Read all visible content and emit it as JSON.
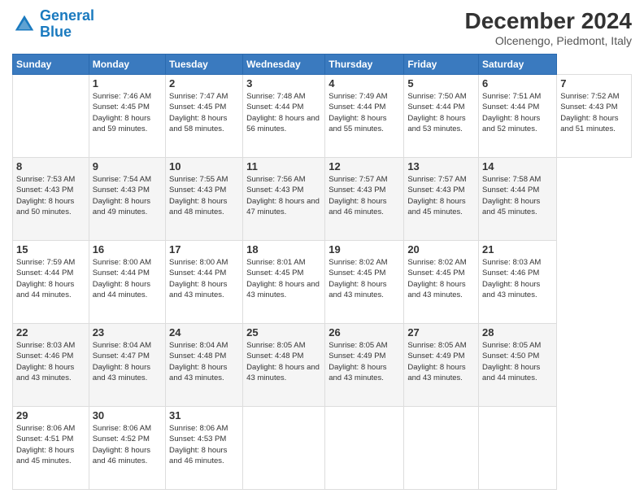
{
  "header": {
    "logo_line1": "General",
    "logo_line2": "Blue",
    "title": "December 2024",
    "subtitle": "Olcenengo, Piedmont, Italy"
  },
  "calendar": {
    "days_of_week": [
      "Sunday",
      "Monday",
      "Tuesday",
      "Wednesday",
      "Thursday",
      "Friday",
      "Saturday"
    ],
    "weeks": [
      [
        null,
        {
          "day": "1",
          "sunrise": "Sunrise: 7:46 AM",
          "sunset": "Sunset: 4:45 PM",
          "daylight": "Daylight: 8 hours and 59 minutes."
        },
        {
          "day": "2",
          "sunrise": "Sunrise: 7:47 AM",
          "sunset": "Sunset: 4:45 PM",
          "daylight": "Daylight: 8 hours and 58 minutes."
        },
        {
          "day": "3",
          "sunrise": "Sunrise: 7:48 AM",
          "sunset": "Sunset: 4:44 PM",
          "daylight": "Daylight: 8 hours and 56 minutes."
        },
        {
          "day": "4",
          "sunrise": "Sunrise: 7:49 AM",
          "sunset": "Sunset: 4:44 PM",
          "daylight": "Daylight: 8 hours and 55 minutes."
        },
        {
          "day": "5",
          "sunrise": "Sunrise: 7:50 AM",
          "sunset": "Sunset: 4:44 PM",
          "daylight": "Daylight: 8 hours and 53 minutes."
        },
        {
          "day": "6",
          "sunrise": "Sunrise: 7:51 AM",
          "sunset": "Sunset: 4:44 PM",
          "daylight": "Daylight: 8 hours and 52 minutes."
        },
        {
          "day": "7",
          "sunrise": "Sunrise: 7:52 AM",
          "sunset": "Sunset: 4:43 PM",
          "daylight": "Daylight: 8 hours and 51 minutes."
        }
      ],
      [
        {
          "day": "8",
          "sunrise": "Sunrise: 7:53 AM",
          "sunset": "Sunset: 4:43 PM",
          "daylight": "Daylight: 8 hours and 50 minutes."
        },
        {
          "day": "9",
          "sunrise": "Sunrise: 7:54 AM",
          "sunset": "Sunset: 4:43 PM",
          "daylight": "Daylight: 8 hours and 49 minutes."
        },
        {
          "day": "10",
          "sunrise": "Sunrise: 7:55 AM",
          "sunset": "Sunset: 4:43 PM",
          "daylight": "Daylight: 8 hours and 48 minutes."
        },
        {
          "day": "11",
          "sunrise": "Sunrise: 7:56 AM",
          "sunset": "Sunset: 4:43 PM",
          "daylight": "Daylight: 8 hours and 47 minutes."
        },
        {
          "day": "12",
          "sunrise": "Sunrise: 7:57 AM",
          "sunset": "Sunset: 4:43 PM",
          "daylight": "Daylight: 8 hours and 46 minutes."
        },
        {
          "day": "13",
          "sunrise": "Sunrise: 7:57 AM",
          "sunset": "Sunset: 4:43 PM",
          "daylight": "Daylight: 8 hours and 45 minutes."
        },
        {
          "day": "14",
          "sunrise": "Sunrise: 7:58 AM",
          "sunset": "Sunset: 4:44 PM",
          "daylight": "Daylight: 8 hours and 45 minutes."
        }
      ],
      [
        {
          "day": "15",
          "sunrise": "Sunrise: 7:59 AM",
          "sunset": "Sunset: 4:44 PM",
          "daylight": "Daylight: 8 hours and 44 minutes."
        },
        {
          "day": "16",
          "sunrise": "Sunrise: 8:00 AM",
          "sunset": "Sunset: 4:44 PM",
          "daylight": "Daylight: 8 hours and 44 minutes."
        },
        {
          "day": "17",
          "sunrise": "Sunrise: 8:00 AM",
          "sunset": "Sunset: 4:44 PM",
          "daylight": "Daylight: 8 hours and 43 minutes."
        },
        {
          "day": "18",
          "sunrise": "Sunrise: 8:01 AM",
          "sunset": "Sunset: 4:45 PM",
          "daylight": "Daylight: 8 hours and 43 minutes."
        },
        {
          "day": "19",
          "sunrise": "Sunrise: 8:02 AM",
          "sunset": "Sunset: 4:45 PM",
          "daylight": "Daylight: 8 hours and 43 minutes."
        },
        {
          "day": "20",
          "sunrise": "Sunrise: 8:02 AM",
          "sunset": "Sunset: 4:45 PM",
          "daylight": "Daylight: 8 hours and 43 minutes."
        },
        {
          "day": "21",
          "sunrise": "Sunrise: 8:03 AM",
          "sunset": "Sunset: 4:46 PM",
          "daylight": "Daylight: 8 hours and 43 minutes."
        }
      ],
      [
        {
          "day": "22",
          "sunrise": "Sunrise: 8:03 AM",
          "sunset": "Sunset: 4:46 PM",
          "daylight": "Daylight: 8 hours and 43 minutes."
        },
        {
          "day": "23",
          "sunrise": "Sunrise: 8:04 AM",
          "sunset": "Sunset: 4:47 PM",
          "daylight": "Daylight: 8 hours and 43 minutes."
        },
        {
          "day": "24",
          "sunrise": "Sunrise: 8:04 AM",
          "sunset": "Sunset: 4:48 PM",
          "daylight": "Daylight: 8 hours and 43 minutes."
        },
        {
          "day": "25",
          "sunrise": "Sunrise: 8:05 AM",
          "sunset": "Sunset: 4:48 PM",
          "daylight": "Daylight: 8 hours and 43 minutes."
        },
        {
          "day": "26",
          "sunrise": "Sunrise: 8:05 AM",
          "sunset": "Sunset: 4:49 PM",
          "daylight": "Daylight: 8 hours and 43 minutes."
        },
        {
          "day": "27",
          "sunrise": "Sunrise: 8:05 AM",
          "sunset": "Sunset: 4:49 PM",
          "daylight": "Daylight: 8 hours and 43 minutes."
        },
        {
          "day": "28",
          "sunrise": "Sunrise: 8:05 AM",
          "sunset": "Sunset: 4:50 PM",
          "daylight": "Daylight: 8 hours and 44 minutes."
        }
      ],
      [
        {
          "day": "29",
          "sunrise": "Sunrise: 8:06 AM",
          "sunset": "Sunset: 4:51 PM",
          "daylight": "Daylight: 8 hours and 45 minutes."
        },
        {
          "day": "30",
          "sunrise": "Sunrise: 8:06 AM",
          "sunset": "Sunset: 4:52 PM",
          "daylight": "Daylight: 8 hours and 46 minutes."
        },
        {
          "day": "31",
          "sunrise": "Sunrise: 8:06 AM",
          "sunset": "Sunset: 4:53 PM",
          "daylight": "Daylight: 8 hours and 46 minutes."
        },
        null,
        null,
        null,
        null
      ]
    ]
  }
}
